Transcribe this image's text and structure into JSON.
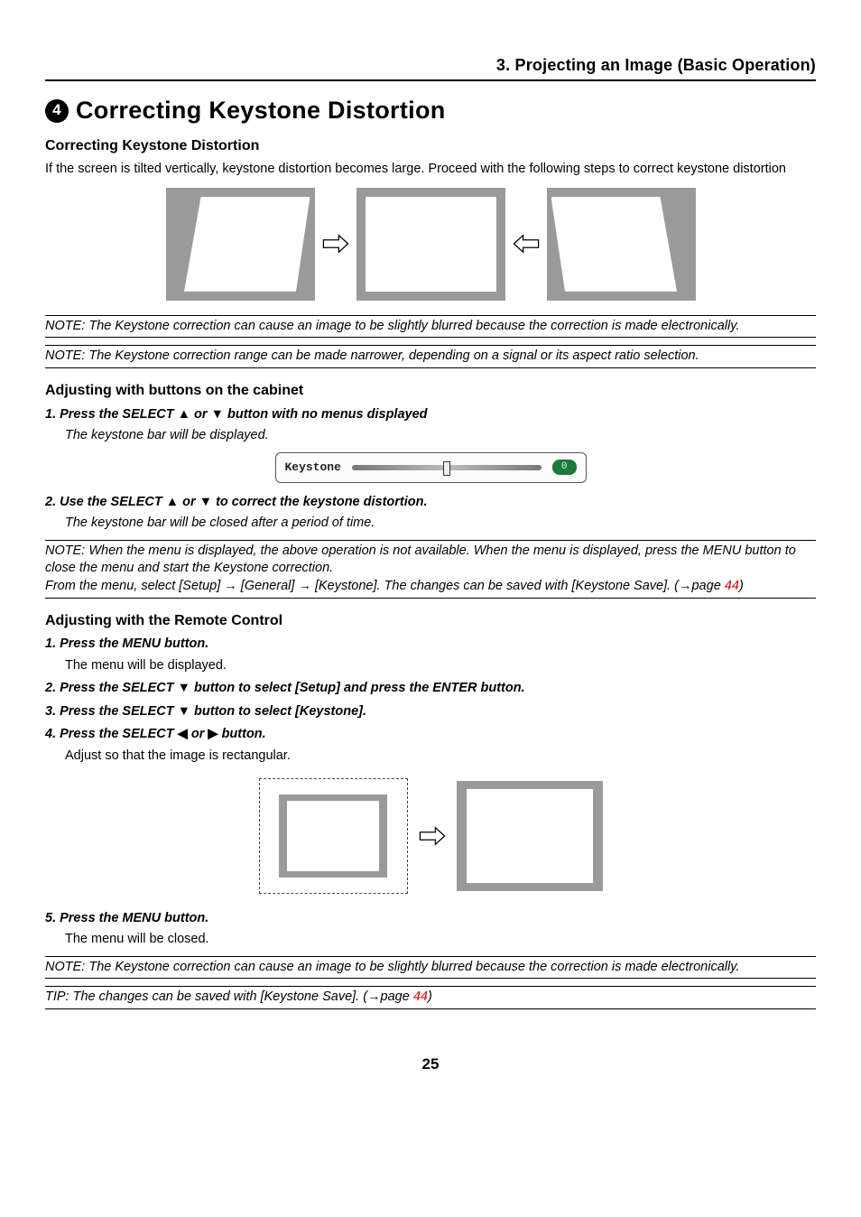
{
  "chapter_header": "3. Projecting an Image (Basic Operation)",
  "section_number": "4",
  "section_title": "Correcting Keystone Distortion",
  "sub1_heading": "Correcting Keystone Distortion",
  "sub1_body": "If the screen is tilted vertically, keystone distortion becomes large. Proceed with the following steps to correct keystone distortion",
  "note1": "NOTE: The Keystone correction can cause an image to be slightly blurred because the correction is made electronically.",
  "note2": "NOTE: The Keystone correction range can be made narrower, depending on a signal or its aspect ratio selection.",
  "sub2_heading": "Adjusting with buttons on the cabinet",
  "cabinet_step1_pre": "1.  Press the SELECT ",
  "cabinet_step1_tri": "▲",
  "cabinet_step1_mid": " or ",
  "cabinet_step1_tri2": "▼",
  "cabinet_step1_post": " button with no menus displayed",
  "cabinet_step1_sub": "The keystone bar will be displayed.",
  "kbar_label": "Keystone",
  "kbar_value": "0",
  "cabinet_step2_pre": "2.  Use the SELECT ",
  "cabinet_step2_tri": "▲",
  "cabinet_step2_mid": " or ",
  "cabinet_step2_tri2": "▼",
  "cabinet_step2_post": " to correct the keystone distortion.",
  "cabinet_step2_sub": "The keystone bar will be closed after a period of time.",
  "note3_line1": "NOTE: When the menu is displayed, the above operation is not available. When the menu is displayed, press the MENU button to close the menu and start the Keystone correction.",
  "note3_line2_pre": "From the menu, select [Setup] → [General] → [Keystone]. The changes can be saved with [Keystone Save]. (→page ",
  "note3_page": "44",
  "note3_line2_post": ")",
  "sub3_heading": "Adjusting with the Remote Control",
  "rc_step1": "1.  Press the MENU button.",
  "rc_step1_sub": "The menu will be displayed.",
  "rc_step2_pre": "2.  Press the SELECT ",
  "rc_step2_tri": "▼",
  "rc_step2_post": " button to select [Setup] and press the ENTER button.",
  "rc_step3_pre": "3.  Press the SELECT ",
  "rc_step3_tri": "▼",
  "rc_step3_post": " button to select [Keystone].",
  "rc_step4_pre": "4.  Press the SELECT ",
  "rc_step4_tri": "◀",
  "rc_step4_mid": " or ",
  "rc_step4_tri2": "▶",
  "rc_step4_post": " button.",
  "rc_step4_sub": "Adjust so that the image is rectangular.",
  "rc_step5": "5.  Press the MENU button.",
  "rc_step5_sub": "The menu will be closed.",
  "note4": "NOTE: The Keystone correction can cause an image to be slightly blurred because the correction is made electronically.",
  "tip_pre": "TIP: The changes can be saved with [Keystone Save]. (→page ",
  "tip_page": "44",
  "tip_post": ")",
  "page_number": "25"
}
